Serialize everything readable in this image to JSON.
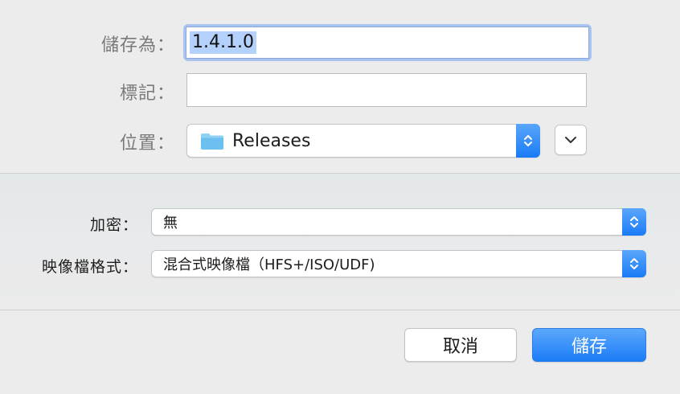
{
  "save_as": {
    "label": "儲存為：",
    "value": "1.4.1.0"
  },
  "tags": {
    "label": "標記：",
    "value": ""
  },
  "where": {
    "label": "位置：",
    "folder": "Releases",
    "folder_icon": "folder-icon"
  },
  "encryption": {
    "label": "加密：",
    "value": "無"
  },
  "image_format": {
    "label": "映像檔格式：",
    "value": "混合式映像檔（HFS+/ISO/UDF)"
  },
  "buttons": {
    "cancel": "取消",
    "save": "儲存"
  },
  "colors": {
    "accent": "#1b7cf6",
    "selection": "#b3d1fb",
    "folder": "#6cc0f0"
  }
}
